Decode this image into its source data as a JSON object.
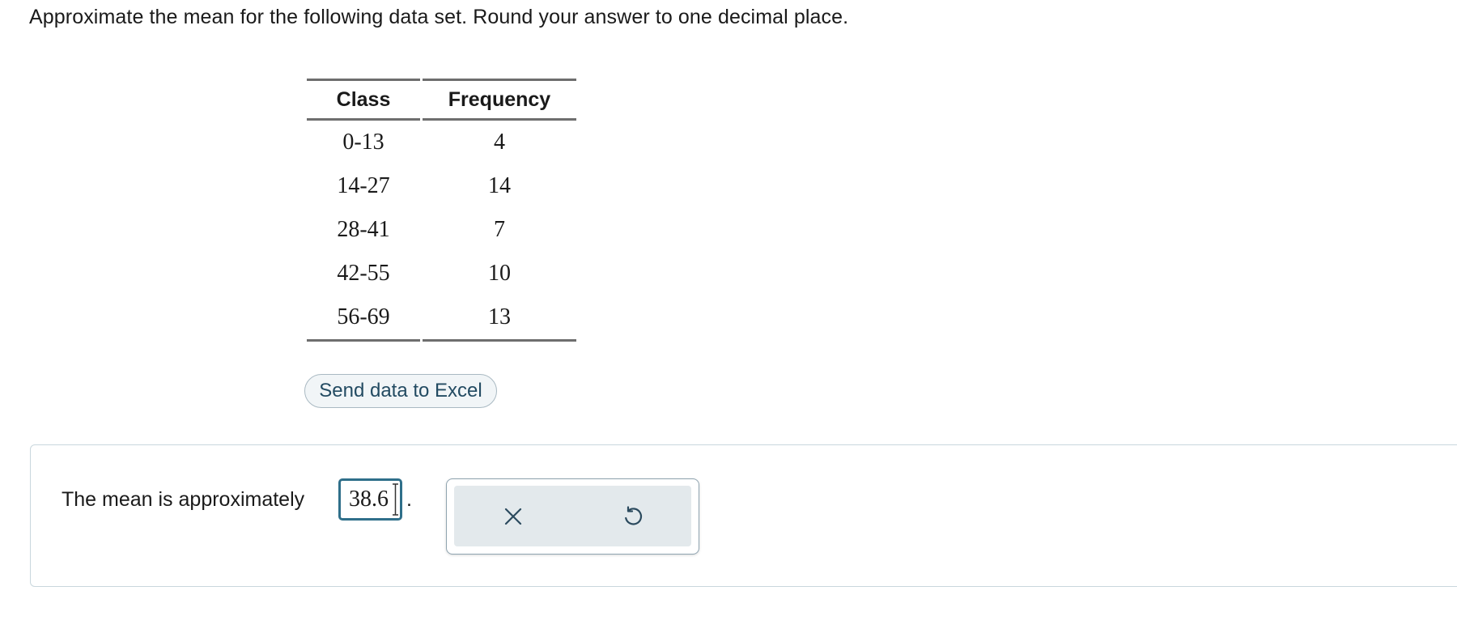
{
  "question": {
    "text": "Approximate the mean for the following data set. Round your answer to one decimal place."
  },
  "table": {
    "headers": [
      "Class",
      "Frequency"
    ],
    "rows": [
      [
        "0-13",
        "4"
      ],
      [
        "14-27",
        "14"
      ],
      [
        "28-41",
        "7"
      ],
      [
        "42-55",
        "10"
      ],
      [
        "56-69",
        "13"
      ]
    ]
  },
  "excel_button": {
    "label": "Send data to Excel"
  },
  "answer": {
    "label": "The mean is approximately",
    "value": "38.6",
    "suffix": "."
  },
  "tools": {
    "clear_icon": "x-icon",
    "undo_icon": "undo-icon"
  },
  "colors": {
    "accent": "#2f6f8a",
    "button_text": "#234b62",
    "tool_bg": "#e3e9ec"
  }
}
